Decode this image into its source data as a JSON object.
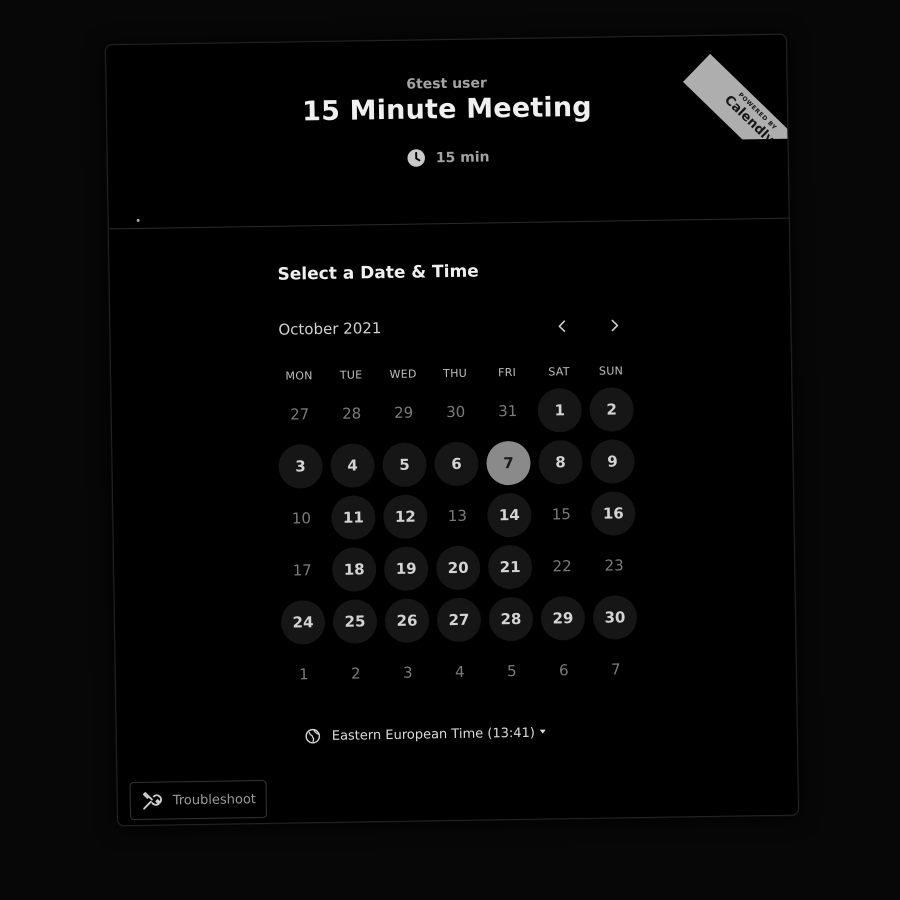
{
  "event": {
    "organizer": "6test user",
    "title": "15 Minute Meeting",
    "duration": "15 min",
    "duration_icon": "clock-icon"
  },
  "badge": {
    "powered_by": "POWERED BY",
    "brand": "Calendly"
  },
  "scheduler": {
    "title": "Select a Date & Time",
    "month": "October 2021",
    "prev_icon": "chevron-left-icon",
    "next_icon": "chevron-right-icon",
    "weekdays": [
      "MON",
      "TUE",
      "WED",
      "THU",
      "FRI",
      "SAT",
      "SUN"
    ],
    "weeks": [
      [
        {
          "d": "27",
          "s": "off"
        },
        {
          "d": "28",
          "s": "off"
        },
        {
          "d": "29",
          "s": "off"
        },
        {
          "d": "30",
          "s": "off"
        },
        {
          "d": "31",
          "s": "off"
        },
        {
          "d": "1",
          "s": "available"
        },
        {
          "d": "2",
          "s": "available"
        }
      ],
      [
        {
          "d": "3",
          "s": "available"
        },
        {
          "d": "4",
          "s": "available"
        },
        {
          "d": "5",
          "s": "available"
        },
        {
          "d": "6",
          "s": "available"
        },
        {
          "d": "7",
          "s": "selected"
        },
        {
          "d": "8",
          "s": "available"
        },
        {
          "d": "9",
          "s": "available"
        }
      ],
      [
        {
          "d": "10",
          "s": "off"
        },
        {
          "d": "11",
          "s": "available"
        },
        {
          "d": "12",
          "s": "available"
        },
        {
          "d": "13",
          "s": "off"
        },
        {
          "d": "14",
          "s": "available"
        },
        {
          "d": "15",
          "s": "off"
        },
        {
          "d": "16",
          "s": "available"
        }
      ],
      [
        {
          "d": "17",
          "s": "off"
        },
        {
          "d": "18",
          "s": "available"
        },
        {
          "d": "19",
          "s": "available"
        },
        {
          "d": "20",
          "s": "available"
        },
        {
          "d": "21",
          "s": "available"
        },
        {
          "d": "22",
          "s": "off"
        },
        {
          "d": "23",
          "s": "off"
        }
      ],
      [
        {
          "d": "24",
          "s": "available"
        },
        {
          "d": "25",
          "s": "available"
        },
        {
          "d": "26",
          "s": "available"
        },
        {
          "d": "27",
          "s": "available"
        },
        {
          "d": "28",
          "s": "available"
        },
        {
          "d": "29",
          "s": "available"
        },
        {
          "d": "30",
          "s": "available"
        }
      ],
      [
        {
          "d": "1",
          "s": "off"
        },
        {
          "d": "2",
          "s": "off"
        },
        {
          "d": "3",
          "s": "off"
        },
        {
          "d": "4",
          "s": "off"
        },
        {
          "d": "5",
          "s": "off"
        },
        {
          "d": "6",
          "s": "off"
        },
        {
          "d": "7",
          "s": "off"
        }
      ]
    ],
    "timezone": "Eastern European Time (13:41)",
    "timezone_icon": "globe-icon"
  },
  "troubleshoot": {
    "label": "Troubleshoot",
    "icon": "wrench-icon"
  },
  "colors": {
    "background": "#000000",
    "available_day": "#161616",
    "selected_day": "#8a8a8a",
    "ribbon": "#aeaeae"
  }
}
